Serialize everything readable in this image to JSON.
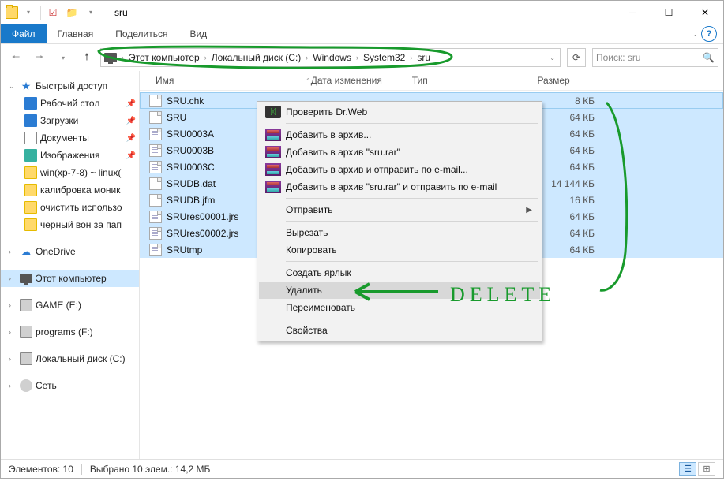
{
  "window": {
    "title": "sru"
  },
  "ribbon": {
    "file": "Файл",
    "tabs": [
      "Главная",
      "Поделиться",
      "Вид"
    ]
  },
  "breadcrumb": [
    "Этот компьютер",
    "Локальный диск (C:)",
    "Windows",
    "System32",
    "sru"
  ],
  "search": {
    "placeholder": "Поиск: sru"
  },
  "columns": {
    "name": "Имя",
    "date": "Дата изменения",
    "type": "Тип",
    "size": "Размер"
  },
  "nav": {
    "quick": "Быстрый доступ",
    "pins": [
      {
        "label": "Рабочий стол",
        "icon": "desktop",
        "pin": true
      },
      {
        "label": "Загрузки",
        "icon": "download",
        "pin": true
      },
      {
        "label": "Документы",
        "icon": "docs",
        "pin": true
      },
      {
        "label": "Изображения",
        "icon": "pic",
        "pin": true
      },
      {
        "label": "win(xp-7-8) ~ linux(",
        "icon": "folder"
      },
      {
        "label": "калибровка моник",
        "icon": "folder"
      },
      {
        "label": "очистить использо",
        "icon": "folder"
      },
      {
        "label": "черный вон за пап",
        "icon": "folder"
      }
    ],
    "onedrive": "OneDrive",
    "thispc": "Этот компьютер",
    "drives": [
      {
        "label": "GAME (E:)"
      },
      {
        "label": "programs (F:)"
      },
      {
        "label": "Локальный диск (C:)"
      }
    ],
    "network": "Сеть"
  },
  "files": [
    {
      "name": "SRU.chk",
      "size": "8 КБ",
      "icon": "file"
    },
    {
      "name": "SRU",
      "size": "64 КБ",
      "icon": "file"
    },
    {
      "name": "SRU0003A",
      "size": "64 КБ",
      "icon": "txt"
    },
    {
      "name": "SRU0003B",
      "size": "64 КБ",
      "icon": "txt"
    },
    {
      "name": "SRU0003C",
      "size": "64 КБ",
      "icon": "txt"
    },
    {
      "name": "SRUDB.dat",
      "size": "14 144 КБ",
      "icon": "file"
    },
    {
      "name": "SRUDB.jfm",
      "size": "16 КБ",
      "icon": "file"
    },
    {
      "name": "SRUres00001.jrs",
      "size": "64 КБ",
      "icon": "txt"
    },
    {
      "name": "SRUres00002.jrs",
      "size": "64 КБ",
      "icon": "txt"
    },
    {
      "name": "SRUtmp",
      "size": "64 КБ",
      "icon": "txt"
    }
  ],
  "context": {
    "drweb": "Проверить Dr.Web",
    "rar1": "Добавить в архив...",
    "rar2": "Добавить в архив \"sru.rar\"",
    "rar3": "Добавить в архив и отправить по e-mail...",
    "rar4": "Добавить в архив \"sru.rar\" и отправить по e-mail",
    "send": "Отправить",
    "cut": "Вырезать",
    "copy": "Копировать",
    "shortcut": "Создать ярлык",
    "delete": "Удалить",
    "rename": "Переименовать",
    "props": "Свойства"
  },
  "status": {
    "count": "Элементов: 10",
    "selected": "Выбрано 10 элем.: 14,2 МБ"
  },
  "annot_text": "DELETE"
}
